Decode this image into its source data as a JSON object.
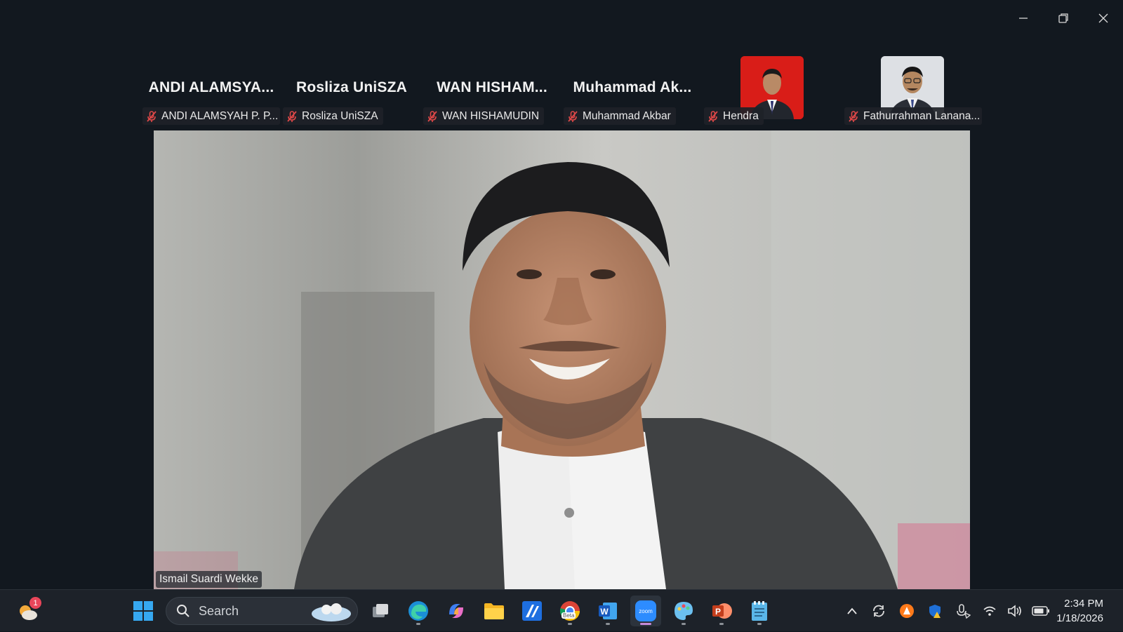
{
  "window": {
    "controls": {
      "minimize": "minimize-icon",
      "restore": "restore-icon",
      "close": "close-icon"
    }
  },
  "participants": [
    {
      "display": "ANDI ALAMSYA...",
      "label": "ANDI ALAMSYAH P. P...",
      "photo": false
    },
    {
      "display": "Rosliza UniSZA",
      "label": "Rosliza UniSZA",
      "photo": false
    },
    {
      "display": "WAN HISHAM...",
      "label": "WAN HISHAMUDIN",
      "photo": false
    },
    {
      "display": "Muhammad Ak...",
      "label": "Muhammad Akbar",
      "photo": false
    },
    {
      "display": "",
      "label": "Hendra",
      "photo": true,
      "photo_bg": "#e0211c"
    },
    {
      "display": "",
      "label": "Fathurrahman Lanana...",
      "photo": true,
      "photo_bg": "#dfe2e6"
    }
  ],
  "speaker": {
    "name": "Ismail Suardi Wekke"
  },
  "taskbar": {
    "weather_badge": "1",
    "search_placeholder": "Search",
    "clock_time": "2:34 PM",
    "clock_date": "1/18/2026",
    "chrome_badge": "Beta",
    "zoom_label": "zoom"
  },
  "colors": {
    "background": "#12181f",
    "muted_red": "#e04848",
    "taskbar": "#1d2229"
  }
}
